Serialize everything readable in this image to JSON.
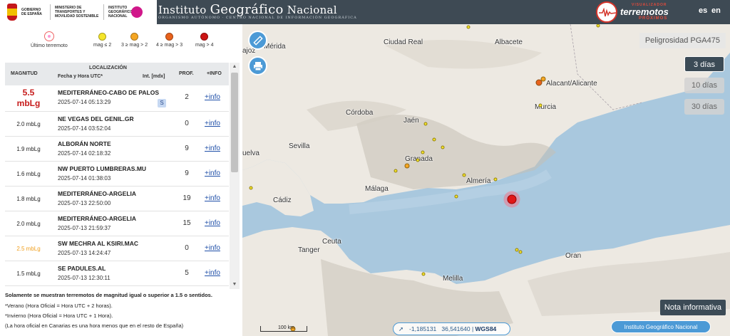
{
  "header": {
    "gov_text_1": "GOBIERNO DE ESPAÑA",
    "gov_text_2": "MINISTERIO DE TRANSPORTES Y MOVILIDAD SOSTENIBLE",
    "gov_text_3": "INSTITUTO GEOGRÁFICO NACIONAL",
    "ign_title_a": "Instituto ",
    "ign_title_b": "Geográfico",
    "ign_title_c": " Nacional",
    "ign_subtitle": "ORGANISMO AUTÓNOMO · CENTRO NACIONAL DE INFORMACIÓN GEOGRÁFICA",
    "brand_top": "VISUALIZADOR",
    "brand_main": "terremotos",
    "brand_bottom": "PRÓXIMOS",
    "lang_es": "es",
    "lang_en": "en"
  },
  "legend": {
    "ultimo": "Último terremoto",
    "items": [
      {
        "label": "mag ≤ 2",
        "color": "#f5e52a"
      },
      {
        "label": "3 ≥ mag > 2",
        "color": "#f5a623"
      },
      {
        "label": "4 ≥ mag > 3",
        "color": "#e8621c"
      },
      {
        "label": "mag > 4",
        "color": "#cc1414"
      }
    ]
  },
  "table": {
    "headers": {
      "magnitud": "MAGNITUD",
      "localizacion": "LOCALIZACIÓN",
      "fecha": "Fecha y Hora UTC*",
      "int": "Int. [mdx]",
      "prof": "PROF.",
      "info": "+INFO"
    },
    "rows": [
      {
        "mag": "5.5",
        "mag_unit": "mbLg",
        "name": "MEDITERRÁNEO-CABO DE PALOS",
        "date": "2025-07-14 05:13:29",
        "badge": "S",
        "prof": "2",
        "info": "+info"
      },
      {
        "mag": "2.0 mbLg",
        "name": "NE VEGAS DEL GENIL.GR",
        "date": "2025-07-14 03:52:04",
        "prof": "0",
        "info": "+info"
      },
      {
        "mag": "1.9 mbLg",
        "name": "ALBORÁN NORTE",
        "date": "2025-07-14 02:18:32",
        "prof": "9",
        "info": "+info"
      },
      {
        "mag": "1.6 mbLg",
        "name": "NW PUERTO LUMBRERAS.MU",
        "date": "2025-07-14 01:38:03",
        "prof": "9",
        "info": "+info"
      },
      {
        "mag": "1.8 mbLg",
        "name": "MEDITERRÁNEO-ARGELIA",
        "date": "2025-07-13 22:50:00",
        "prof": "19",
        "info": "+info"
      },
      {
        "mag": "2.0 mbLg",
        "name": "MEDITERRÁNEO-ARGELIA",
        "date": "2025-07-13 21:59:37",
        "prof": "15",
        "info": "+info"
      },
      {
        "mag": "2.5 mbLg",
        "name": "SW MECHRA AL KSIRI.MAC",
        "date": "2025-07-13 14:24:47",
        "prof": "0",
        "info": "+info"
      },
      {
        "mag": "1.5 mbLg",
        "name": "SE PADULES.AL",
        "date": "2025-07-13 12:30:11",
        "prof": "5",
        "info": "+info"
      }
    ]
  },
  "notes": {
    "n1": "Solamente se muestran terremotos de magnitud igual o superior a 1.5 o sentidos.",
    "n2": "*Verano (Hora Oficial = Hora UTC + 2 horas).",
    "n3": "*Invierno (Hora Oficial = Hora UTC + 1 Hora).",
    "n4": "(La hora oficial en Canarias es una hora menos que en el resto de España)"
  },
  "map": {
    "cities": [
      "Mérida",
      "Ciudad Real",
      "Albacete",
      "Alacant/Alicante",
      "Murcia",
      "Córdoba",
      "Jaén",
      "Sevilla",
      "Granada",
      "Almería",
      "Málaga",
      "Cádiz",
      "Ceuta",
      "Tanger",
      "Oran",
      "Melilla",
      "ajoz",
      "uelva"
    ],
    "peligrosidad": "Peligrosidad PGA475",
    "day_buttons": [
      "3 días",
      "10 días",
      "30 días"
    ],
    "nota": "Nota informativa",
    "ign_badge": "Instituto Geográfico Nacional",
    "coords_lon": "-1,185131",
    "coords_lat": "36,541640",
    "coords_sys": "WGS84",
    "scale": "100 km"
  }
}
